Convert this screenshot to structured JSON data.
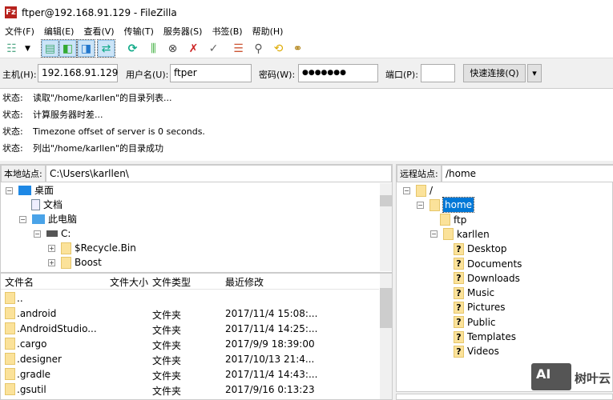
{
  "window": {
    "title": "ftper@192.168.91.129 - FileZilla",
    "logo": "Fz"
  },
  "menu": [
    "文件(F)",
    "编辑(E)",
    "查看(V)",
    "传输(T)",
    "服务器(S)",
    "书签(B)",
    "帮助(H)"
  ],
  "toolbar": [
    "site-manager-icon",
    "dropdown-icon",
    "message-log-icon",
    "local-tree-icon",
    "remote-tree-icon",
    "transfer-queue-icon",
    "refresh-icon",
    "process-queue-icon",
    "cancel-icon",
    "disconnect-icon",
    "reconnect-icon",
    "filter-icon",
    "compare-icon",
    "sync-browse-icon",
    "search-icon"
  ],
  "quickconnect": {
    "host_label": "主机(H):",
    "host": "192.168.91.129",
    "user_label": "用户名(U):",
    "user": "ftper",
    "pass_label": "密码(W):",
    "pass": "●●●●●●●",
    "port_label": "端口(P):",
    "port": "",
    "button": "快速连接(Q)",
    "dropdown": "▾"
  },
  "log": [
    {
      "k": "状态:",
      "v": "读取\"/home/karllen\"的目录列表..."
    },
    {
      "k": "状态:",
      "v": "计算服务器时差..."
    },
    {
      "k": "状态:",
      "v": "Timezone offset of server is 0 seconds."
    },
    {
      "k": "状态:",
      "v": "列出\"/home/karllen\"的目录成功"
    }
  ],
  "local": {
    "label": "本地站点:",
    "path": "C:\\Users\\karllen\\",
    "tree": [
      "桌面",
      "文档",
      "此电脑",
      "C:",
      "$Recycle.Bin",
      "Boost"
    ],
    "columns": [
      "文件名",
      "文件大小",
      "文件类型",
      "最近修改"
    ],
    "files": [
      {
        "name": "..",
        "type": "",
        "date": ""
      },
      {
        "name": ".android",
        "type": "文件夹",
        "date": "2017/11/4 15:08:..."
      },
      {
        "name": ".AndroidStudio...",
        "type": "文件夹",
        "date": "2017/11/4 14:25:..."
      },
      {
        "name": ".cargo",
        "type": "文件夹",
        "date": "2017/9/9 18:39:00"
      },
      {
        "name": ".designer",
        "type": "文件夹",
        "date": "2017/10/13 21:4..."
      },
      {
        "name": ".gradle",
        "type": "文件夹",
        "date": "2017/11/4 14:43:..."
      },
      {
        "name": ".gsutil",
        "type": "文件夹",
        "date": "2017/9/16 0:13:23"
      }
    ]
  },
  "remote": {
    "label": "远程站点:",
    "path": "/home",
    "tree": [
      "/",
      "home",
      "ftp",
      "karllen",
      "Desktop",
      "Documents",
      "Downloads",
      "Music",
      "Pictures",
      "Public",
      "Templates",
      "Videos"
    ]
  },
  "watermark": {
    "logo": "AI",
    "text": "树叶云"
  }
}
